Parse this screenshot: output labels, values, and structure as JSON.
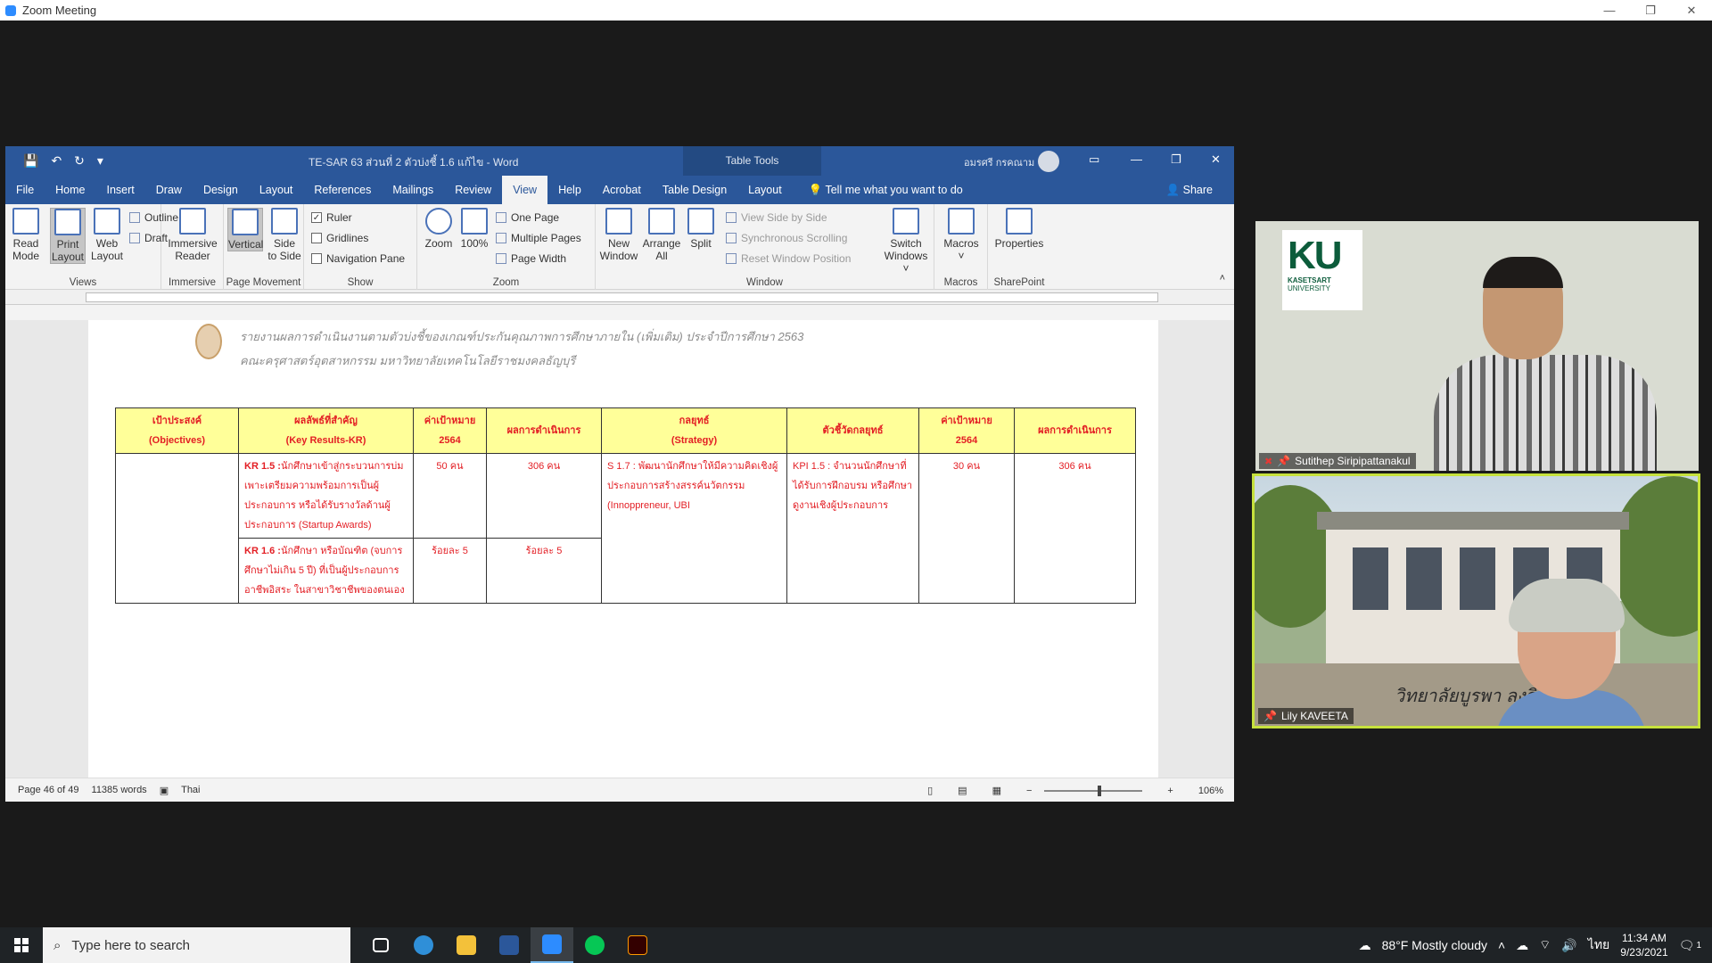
{
  "zoom": {
    "title": "Zoom Meeting",
    "controls": [
      "—",
      "❐",
      "✕"
    ]
  },
  "word": {
    "doc_title": "TE-SAR 63 ส่วนที่ 2 ตัวบ่งชี้ 1.6 แก้ไข  -  Word",
    "table_tools": "Table Tools",
    "user_name": "อมรศรี กรคณาม",
    "tabs": [
      "File",
      "Home",
      "Insert",
      "Draw",
      "Design",
      "Layout",
      "References",
      "Mailings",
      "Review",
      "View",
      "Help",
      "Acrobat",
      "Table Design",
      "Layout"
    ],
    "active_tab": "View",
    "tell_me": "Tell me what you want to do",
    "share": "Share",
    "ribbon": {
      "views": {
        "label": "Views",
        "read_mode": [
          "Read",
          "Mode"
        ],
        "print_layout": [
          "Print",
          "Layout"
        ],
        "web_layout": [
          "Web",
          "Layout"
        ],
        "outline": "Outline",
        "draft": "Draft"
      },
      "immersive": {
        "label": "Immersive",
        "reader": [
          "Immersive",
          "Reader"
        ]
      },
      "page_movement": {
        "label": "Page Movement",
        "vertical": "Vertical",
        "side": [
          "Side",
          "to Side"
        ]
      },
      "show": {
        "label": "Show",
        "ruler": "Ruler",
        "gridlines": "Gridlines",
        "navigation": "Navigation Pane"
      },
      "zoom": {
        "label": "Zoom",
        "zoom": "Zoom",
        "hundred": "100%",
        "one_page": "One Page",
        "multiple": "Multiple Pages",
        "page_width": "Page Width"
      },
      "window": {
        "label": "Window",
        "new_window": [
          "New",
          "Window"
        ],
        "arrange": [
          "Arrange",
          "All"
        ],
        "split": "Split",
        "side_by_side": "View Side by Side",
        "sync_scroll": "Synchronous Scrolling",
        "reset": "Reset Window Position",
        "switch": [
          "Switch",
          "Windows ˅"
        ]
      },
      "macros": {
        "label": "Macros",
        "macros": "Macros"
      },
      "sharepoint": {
        "label": "SharePoint",
        "properties": "Properties"
      }
    },
    "doc_header": {
      "line1": "รายงานผลการดำเนินงานตามตัวบ่งชี้ของเกณฑ์ประกันคุณภาพการศึกษาภายใน (เพิ่มเติม) ประจำปีการศึกษา 2563",
      "line2": "คณะครุศาสตร์อุตสาหกรรม มหาวิทยาลัยเทคโนโลยีราชมงคลธัญบุรี"
    },
    "table": {
      "headers": [
        [
          "เป้าประสงค์",
          "(Objectives)"
        ],
        [
          "ผลลัพธ์ที่สำคัญ",
          "(Key Results-KR)"
        ],
        [
          "ค่าเป้าหมาย",
          "2564"
        ],
        [
          "ผลการดำเนินการ",
          ""
        ],
        [
          "กลยุทธ์",
          "(Strategy)"
        ],
        [
          "ตัวชี้วัดกลยุทธ์",
          ""
        ],
        [
          "ค่าเป้าหมาย",
          "2564"
        ],
        [
          "ผลการดำเนินการ",
          ""
        ]
      ],
      "kr15_id": "KR 1.5 :",
      "kr15_text": "นักศึกษาเข้าสู่กระบวนการบ่มเพาะเตรียมความพร้อมการเป็นผู้ประกอบการ หรือได้รับรางวัลด้านผู้ประกอบการ (Startup Awards)",
      "kr15_target": "50 คน",
      "kr15_result": "306 คน",
      "strategy": "S 1.7 : พัฒนานักศึกษาให้มีความคิดเชิงผู้ประกอบการสร้างสรรค์นวัตกรรม (Innoppreneur, UBI",
      "kpi": "KPI 1.5 : จำนวนนักศึกษาที่ได้รับการฝึกอบรม หรือศึกษาดูงานเชิงผู้ประกอบการ",
      "kpi_target": "30 คน",
      "kpi_result": "306 คน",
      "kr16_id": "KR 1.6 :",
      "kr16_text": "นักศึกษา หรือบัณฑิต (จบการศึกษาไม่เกิน 5 ปี) ที่เป็นผู้ประกอบการอาชีพอิสระ ในสาขาวิชาชีพของตนเอง",
      "kr16_target": "ร้อยละ 5",
      "kr16_result": "ร้อยละ 5"
    },
    "status": {
      "page": "Page 46 of 49",
      "words": "11385 words",
      "lang": "Thai",
      "zoom": "106%"
    }
  },
  "participants": [
    {
      "name": "Sutithep Siripipattanakul",
      "logo_big": "KU",
      "logo_small1": "KASETSART",
      "logo_small2": "UNIVERSITY"
    },
    {
      "name": "Lily KAVEETA",
      "sign": "วิทยาลัยบูรพา   ลงวิทย์"
    }
  ],
  "taskbar": {
    "search_placeholder": "Type here to search",
    "weather": "88°F  Mostly cloudy",
    "lang": "ไทย",
    "time": "11:34 AM",
    "date": "9/23/2021",
    "notif": "1"
  }
}
